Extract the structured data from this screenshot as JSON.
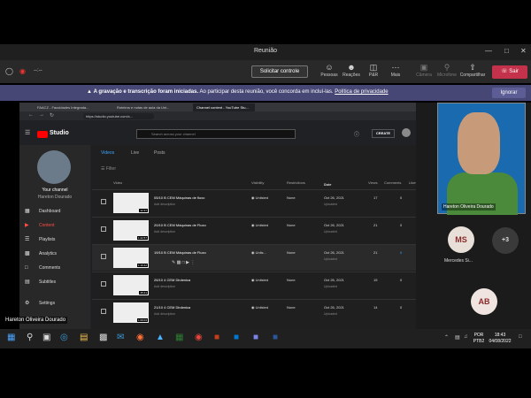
{
  "window": {
    "title": "Reunião"
  },
  "toolbar": {
    "timer": "--:--",
    "request_control": "Solicitar controle",
    "items": [
      {
        "label": "Pessoas",
        "icon": "people-icon"
      },
      {
        "label": "Reações",
        "icon": "reactions-icon"
      },
      {
        "label": "P&R",
        "icon": "qa-icon"
      },
      {
        "label": "Mais",
        "icon": "more-icon"
      },
      {
        "label": "Câmera",
        "icon": "camera-off-icon"
      },
      {
        "label": "Microfone",
        "icon": "mic-off-icon"
      },
      {
        "label": "Compartilhar",
        "icon": "share-icon"
      }
    ],
    "leave": "Sair"
  },
  "banner": {
    "bold": "A gravação e transcrição foram iniciadas.",
    "text": "Ao participar desta reunião, você concorda em incluí-las.",
    "link": "Política de privacidade",
    "ignore": "Ignorar"
  },
  "browser": {
    "tabs": [
      "FAACZ - Faculdades Integrada...",
      "Roteiros e notas de aula da Uni...",
      "Channel content - YouTube Stu..."
    ],
    "url": "https://studio.youtube.com/c..."
  },
  "studio": {
    "brand": "Studio",
    "search_placeholder": "Search across your channel",
    "create": "CREATE",
    "channel_label": "Your channel",
    "channel_name": "Hareton Dourado",
    "sidebar": [
      "Dashboard",
      "Content",
      "Playlists",
      "Analytics",
      "Comments",
      "Subtitles",
      "Settings"
    ],
    "tabs": [
      "Videos",
      "Live",
      "Posts"
    ],
    "filter": "Filter",
    "columns": [
      "Video",
      "Visibility",
      "Restrictions",
      "Date",
      "Views",
      "Comments",
      "Likes (vs. disli"
    ],
    "rows": [
      {
        "title": "05/10 B CEM Máquinas de fluxo",
        "desc": "Add description",
        "duration": "42:37",
        "visibility": "Unlisted",
        "restrictions": "None",
        "date": "Oct 26, 2021",
        "status": "Uploaded",
        "views": "17",
        "comments": "0"
      },
      {
        "title": "20/10 B CEM Máquinas de Fluxo",
        "desc": "Add description",
        "duration": "1:22:57",
        "visibility": "Unlisted",
        "restrictions": "None",
        "date": "Oct 26, 2021",
        "status": "Uploaded",
        "views": "21",
        "comments": "0"
      },
      {
        "title": "19/10 B CEM Máquinas de Fluxo",
        "desc": "",
        "duration": "1:19:42",
        "visibility": "Unlis...",
        "restrictions": "None",
        "date": "Oct 26, 2021",
        "status": "Uploaded",
        "views": "21",
        "comments": "0"
      },
      {
        "title": "26/10 4 CEM Dinâmica",
        "desc": "Add description",
        "duration": "35:41",
        "visibility": "Unlisted",
        "restrictions": "None",
        "date": "Oct 26, 2021",
        "status": "Uploaded",
        "views": "15",
        "comments": "0"
      },
      {
        "title": "21/10 4 CEM Dinâmica",
        "desc": "Add description",
        "duration": "1:08:03",
        "visibility": "Unlisted",
        "restrictions": "None",
        "date": "Oct 26, 2021",
        "status": "Uploaded",
        "views": "14",
        "comments": "0"
      }
    ]
  },
  "participants": {
    "speaker": "Hareton Oliveira Dourado",
    "ms_initials": "MS",
    "ms_name": "Mercedes Si...",
    "more": "+3",
    "ab_initials": "AB"
  },
  "presenter": "Hareton Oliveira Dourado",
  "taskbar": {
    "lang": "POR",
    "layout": "PTB2",
    "time": "18:43",
    "date": "04/08/2022"
  }
}
